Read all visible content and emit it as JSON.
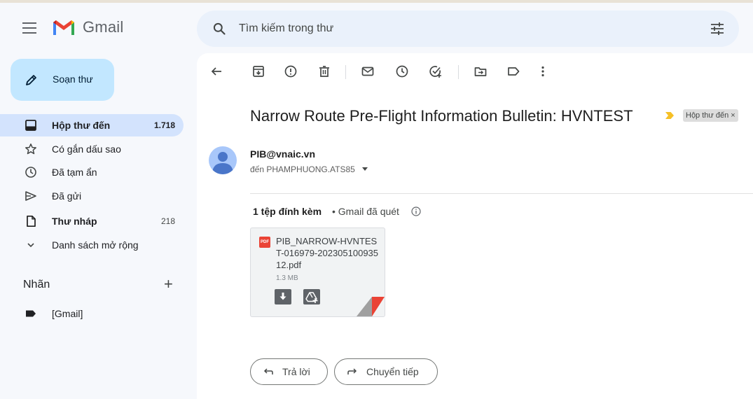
{
  "app": {
    "name": "Gmail"
  },
  "search": {
    "placeholder": "Tìm kiếm trong thư"
  },
  "compose": {
    "label": "Soạn thư"
  },
  "sidebar": {
    "items": [
      {
        "label": "Hộp thư đến",
        "count": "1.718",
        "icon": "inbox-icon",
        "active": true
      },
      {
        "label": "Có gắn dấu sao",
        "count": "",
        "icon": "star-icon"
      },
      {
        "label": "Đã tạm ẩn",
        "count": "",
        "icon": "clock-icon"
      },
      {
        "label": "Đã gửi",
        "count": "",
        "icon": "send-icon"
      },
      {
        "label": "Thư nháp",
        "count": "218",
        "icon": "draft-icon"
      },
      {
        "label": "Danh sách mở rộng",
        "count": "",
        "icon": "chevron-down-icon"
      }
    ],
    "labels_heading": "Nhãn",
    "labels": [
      {
        "label": "[Gmail]",
        "icon": "label-icon"
      }
    ]
  },
  "toolbar": {
    "icons": [
      "back-arrow-icon",
      "archive-icon",
      "report-spam-icon",
      "delete-icon",
      "mark-unread-icon",
      "snooze-icon",
      "add-task-icon",
      "move-to-icon",
      "label-icon",
      "more-vert-icon"
    ]
  },
  "email": {
    "subject": "Narrow Route Pre-Flight Information Bulletin: HVNTEST",
    "label_chip": "Hộp thư đến ×",
    "sender": "PIB@vnaic.vn",
    "recipient": "đến PHAMPHUONG.ATS85"
  },
  "attachments": {
    "heading": "1 tệp đính kèm",
    "scan_note": "• Gmail đã quét",
    "files": [
      {
        "type_badge": "PDF",
        "name": "PIB_NARROW-HVNTEST-016979-20230510093512.pdf",
        "size": "1.3 MB"
      }
    ]
  },
  "actions": {
    "reply": "Trả lời",
    "forward": "Chuyển tiếp"
  },
  "colors": {
    "compose_bg": "#c2e7ff",
    "active_nav": "#d3e3fd",
    "search_bg": "#eaf1fb",
    "page_bg": "#f6f8fc",
    "pdf_red": "#ea4335",
    "importance": "#f6c026"
  }
}
